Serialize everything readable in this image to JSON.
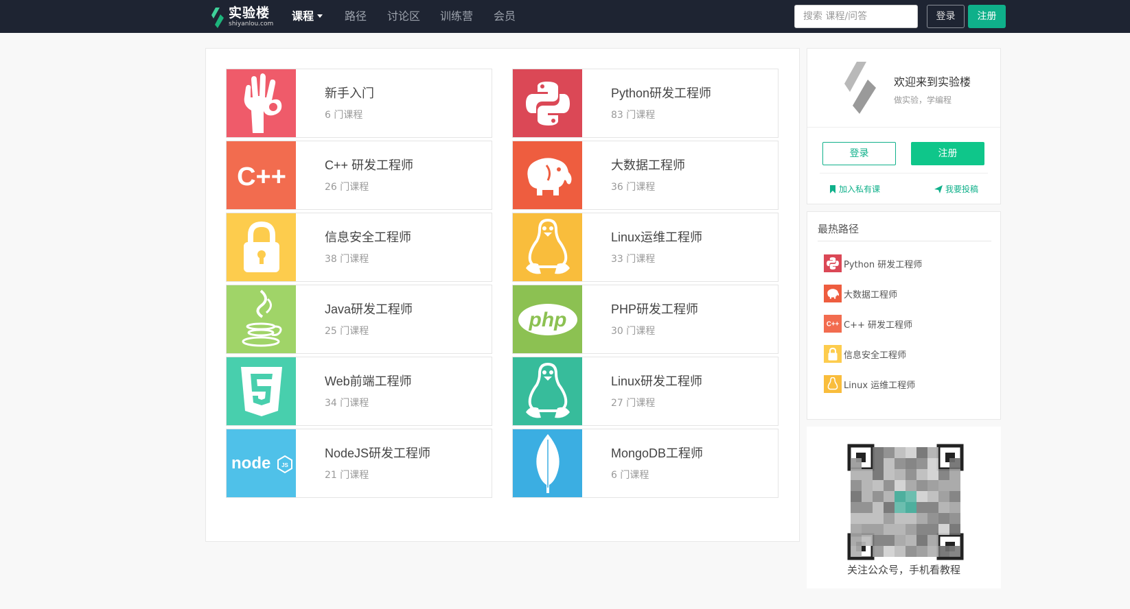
{
  "navbar": {
    "logo_text": "实验楼",
    "logo_sub": "shiyanlou.com",
    "items": [
      {
        "label": "课程"
      },
      {
        "label": "路径"
      },
      {
        "label": "讨论区"
      },
      {
        "label": "训练营"
      },
      {
        "label": "会员"
      }
    ],
    "search_placeholder": "搜索 课程/问答",
    "login_label": "登录",
    "register_label": "注册"
  },
  "cards": [
    {
      "title": "新手入门",
      "count": "6 门课程",
      "icon": "ok-hand-icon",
      "color": "#ef5b6a"
    },
    {
      "title": "Python研发工程师",
      "count": "83 门课程",
      "icon": "python-icon",
      "color": "#db4856"
    },
    {
      "title": "C++ 研发工程师",
      "count": "26 门课程",
      "icon": "cpp-icon",
      "color": "#f26c4f"
    },
    {
      "title": "大数据工程师",
      "count": "36 门课程",
      "icon": "hadoop-elephant-icon",
      "color": "#ee5d3f"
    },
    {
      "title": "信息安全工程师",
      "count": "38 门课程",
      "icon": "lock-icon",
      "color": "#fdcc4d"
    },
    {
      "title": "Linux运维工程师",
      "count": "33 门课程",
      "icon": "tux-penguin-icon",
      "color": "#f9bd3c"
    },
    {
      "title": "Java研发工程师",
      "count": "25 门课程",
      "icon": "java-cup-icon",
      "color": "#a0d468"
    },
    {
      "title": "PHP研发工程师",
      "count": "30 门课程",
      "icon": "php-icon",
      "color": "#8cc152"
    },
    {
      "title": "Web前端工程师",
      "count": "34 门课程",
      "icon": "html5-icon",
      "color": "#48cfad"
    },
    {
      "title": "Linux研发工程师",
      "count": "27 门课程",
      "icon": "tux-penguin-icon",
      "color": "#37bc9b"
    },
    {
      "title": "NodeJS研发工程师",
      "count": "21 门课程",
      "icon": "nodejs-icon",
      "color": "#4fc1e9"
    },
    {
      "title": "MongoDB工程师",
      "count": "6 门课程",
      "icon": "mongodb-leaf-icon",
      "color": "#3baee2"
    }
  ],
  "welcome": {
    "title": "欢迎来到实验楼",
    "subtitle": "做实验，学编程",
    "login_label": "登录",
    "register_label": "注册",
    "join_private_label": "加入私有课",
    "contribute_label": "我要投稿"
  },
  "hot_paths": {
    "title": "最热路径",
    "items": [
      {
        "label": "Python 研发工程师",
        "icon": "python-icon",
        "color": "#db4856"
      },
      {
        "label": "大数据工程师",
        "icon": "hadoop-elephant-icon",
        "color": "#ee5d3f"
      },
      {
        "label": "C++ 研发工程师",
        "icon": "cpp-icon",
        "color": "#f26c4f"
      },
      {
        "label": "信息安全工程师",
        "icon": "lock-icon",
        "color": "#fdcc4d"
      },
      {
        "label": "Linux 运维工程师",
        "icon": "tux-penguin-icon",
        "color": "#f9bd3c"
      }
    ]
  },
  "qr": {
    "caption": "关注公众号，手机看教程"
  },
  "colors": {
    "navbar_bg": "#1e2432",
    "accent": "#0fb08a"
  }
}
